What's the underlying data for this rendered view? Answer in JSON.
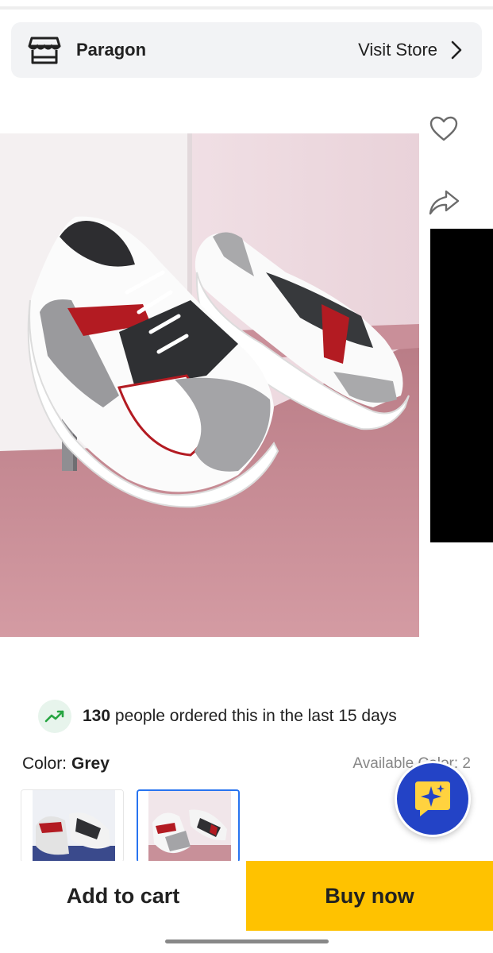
{
  "store": {
    "icon": "storefront-icon",
    "name": "Paragon",
    "visit_label": "Visit Store",
    "chevron_icon": "chevron-right-icon"
  },
  "product": {
    "image_alt": "Grey, white and red sneakers",
    "wishlist_icon": "heart-outline-icon",
    "share_icon": "share-arrow-icon"
  },
  "social_proof": {
    "icon": "trending-up-icon",
    "count": "130",
    "text": "people ordered this in the last 15 days"
  },
  "color": {
    "label": "Color:",
    "selected": "Grey",
    "available": "Available Color: 2",
    "options": [
      {
        "name": "color-option-1",
        "selected": false
      },
      {
        "name": "color-option-2",
        "selected": true
      }
    ]
  },
  "assistant": {
    "icon": "sparkle-chat-icon"
  },
  "actions": {
    "add_to_cart": "Add to cart",
    "buy_now": "Buy now"
  },
  "colors": {
    "buy_now_bg": "#ffc200",
    "selected_border": "#2874f0",
    "trend_green": "#26a541",
    "assistant_blue": "#2343c6"
  }
}
